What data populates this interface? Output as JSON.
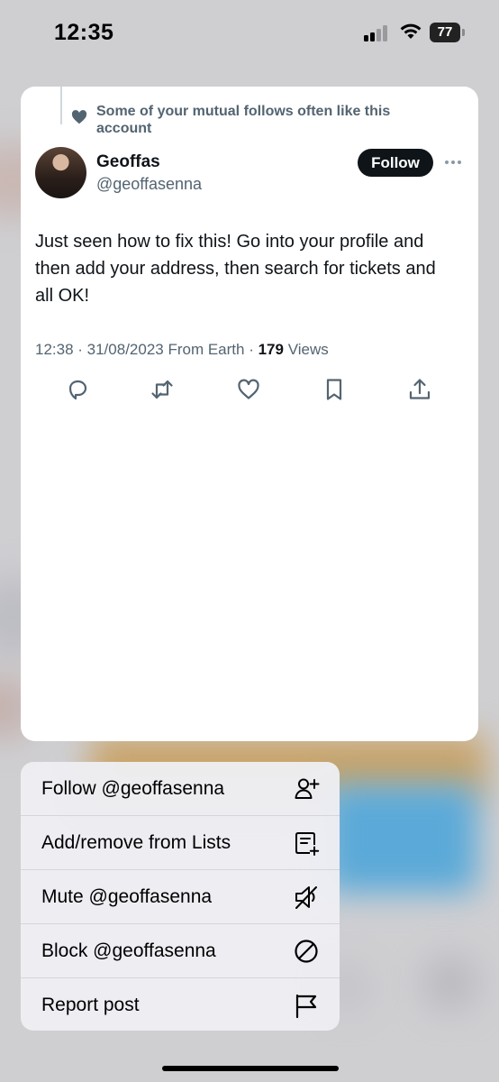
{
  "status_bar": {
    "time": "12:35",
    "battery": "77"
  },
  "tweet": {
    "social_context": "Some of your mutual follows often like this account",
    "author_name": "Geoffas",
    "author_handle": "@geoffasenna",
    "follow_label": "Follow",
    "text": "Just seen how to fix this! Go into your profile and then add your address, then search for tickets and all OK!",
    "timestamp": "12:38 · 31/08/2023 From Earth · ",
    "views_count": "179",
    "views_label": " Views",
    "actions": [
      "reply-icon",
      "retweet-icon",
      "like-icon",
      "bookmark-icon",
      "share-icon"
    ]
  },
  "menu": {
    "items": [
      {
        "label": "Follow @geoffasenna",
        "icon": "follow-user-icon"
      },
      {
        "label": "Add/remove from Lists",
        "icon": "list-add-icon"
      },
      {
        "label": "Mute @geoffasenna",
        "icon": "mute-icon"
      },
      {
        "label": "Block @geoffasenna",
        "icon": "block-icon"
      },
      {
        "label": "Report post",
        "icon": "flag-icon"
      }
    ]
  },
  "colors": {
    "text": "#0f1419",
    "secondary": "#536471",
    "follow_button": "#0f1419"
  }
}
